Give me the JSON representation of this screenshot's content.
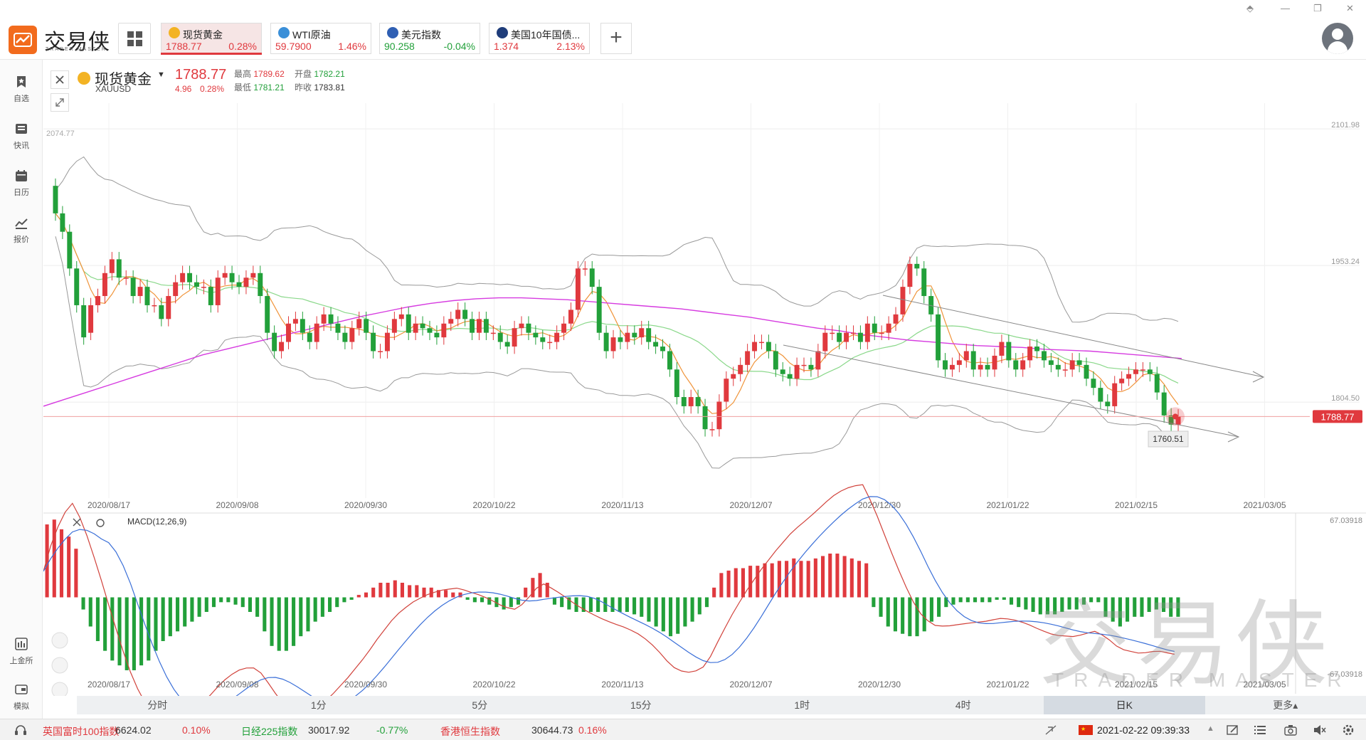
{
  "app": {
    "brand": "交易侠",
    "brand_sub": "TRADER MASTER",
    "window_controls": [
      "⬘",
      "—",
      "❐",
      "✕"
    ]
  },
  "tickers": [
    {
      "name": "现货黄金",
      "price": "1788.77",
      "change": "0.28%",
      "icon_color": "#f3b324",
      "price_color": "#e0393e",
      "active": true
    },
    {
      "name": "WTI原油",
      "price": "59.7900",
      "change": "1.46%",
      "icon_color": "#3a8fd8",
      "price_color": "#e0393e",
      "active": false
    },
    {
      "name": "美元指数",
      "price": "90.258",
      "change": "-0.04%",
      "icon_color": "#2f5fb3",
      "price_color": "#22a03a",
      "active": false
    },
    {
      "name": "美国10年国债...",
      "price": "1.374",
      "change": "2.13%",
      "icon_color": "#1f3d7a",
      "price_color": "#e0393e",
      "active": false
    }
  ],
  "sidebar": {
    "items": [
      {
        "label": "自选",
        "icon": "star-bookmark-icon"
      },
      {
        "label": "快讯",
        "icon": "news-icon"
      },
      {
        "label": "日历",
        "icon": "calendar-icon"
      },
      {
        "label": "报价",
        "icon": "trend-icon"
      }
    ],
    "bottom_items": [
      {
        "label": "上金所",
        "icon": "exchange-icon"
      },
      {
        "label": "模拟",
        "icon": "simulate-icon"
      }
    ]
  },
  "instrument": {
    "name": "现货黄金",
    "code": "XAUUSD",
    "price": "1788.77",
    "change": "4.96",
    "change_pct": "0.28%",
    "stats": {
      "high_label": "最高",
      "high": "1789.62",
      "open_label": "开盘",
      "open": "1782.21",
      "low_label": "最低",
      "low": "1781.21",
      "prev_label": "昨收",
      "prev": "1783.81"
    }
  },
  "chart_data": [
    {
      "type": "candlestick",
      "y_axis_labels": [
        "2101.98",
        "1953.24",
        "1804.50"
      ],
      "top_left_label": "2074.77",
      "last_price_tag": "1788.77",
      "low_tag": "1760.51",
      "x_labels": [
        "2020/08/17",
        "2020/09/08",
        "2020/09/30",
        "2020/10/22",
        "2020/11/13",
        "2020/12/07",
        "2020/12/30",
        "2021/01/22",
        "2021/02/15",
        "2021/03/05"
      ],
      "ylim": [
        1700,
        2130
      ],
      "close": [
        2010,
        1990,
        1950,
        1910,
        1875,
        1910,
        1920,
        1945,
        1960,
        1940,
        1940,
        1920,
        1930,
        1910,
        1910,
        1895,
        1920,
        1935,
        1945,
        1935,
        1930,
        1930,
        1910,
        1940,
        1945,
        1935,
        1930,
        1940,
        1945,
        1920,
        1880,
        1860,
        1870,
        1890,
        1895,
        1880,
        1870,
        1890,
        1900,
        1890,
        1880,
        1870,
        1885,
        1895,
        1880,
        1860,
        1860,
        1880,
        1895,
        1900,
        1880,
        1890,
        1885,
        1880,
        1875,
        1890,
        1895,
        1905,
        1895,
        1880,
        1895,
        1880,
        1880,
        1870,
        1865,
        1885,
        1890,
        1880,
        1875,
        1870,
        1870,
        1880,
        1890,
        1905,
        1950,
        1950,
        1930,
        1880,
        1860,
        1875,
        1870,
        1880,
        1875,
        1885,
        1870,
        1865,
        1860,
        1840,
        1810,
        1800,
        1810,
        1800,
        1775,
        1775,
        1805,
        1830,
        1835,
        1845,
        1860,
        1870,
        1870,
        1860,
        1840,
        1835,
        1830,
        1845,
        1845,
        1840,
        1860,
        1880,
        1880,
        1870,
        1880,
        1880,
        1870,
        1890,
        1880,
        1880,
        1890,
        1900,
        1930,
        1955,
        1950,
        1920,
        1900,
        1850,
        1840,
        1845,
        1850,
        1860,
        1840,
        1845,
        1840,
        1855,
        1870,
        1850,
        1840,
        1850,
        1865,
        1860,
        1850,
        1845,
        1840,
        1840,
        1850,
        1845,
        1830,
        1820,
        1805,
        1800,
        1825,
        1830,
        1835,
        1840,
        1840,
        1835,
        1815,
        1790,
        1780,
        1788.77
      ],
      "open": [
        2040,
        2010,
        1990,
        1950,
        1910,
        1880,
        1910,
        1920,
        1945,
        1960,
        1940,
        1940,
        1920,
        1930,
        1910,
        1910,
        1895,
        1920,
        1935,
        1945,
        1935,
        1930,
        1930,
        1910,
        1940,
        1945,
        1935,
        1930,
        1940,
        1945,
        1920,
        1880,
        1860,
        1870,
        1890,
        1895,
        1880,
        1870,
        1890,
        1900,
        1890,
        1880,
        1870,
        1885,
        1895,
        1880,
        1860,
        1860,
        1880,
        1895,
        1900,
        1880,
        1890,
        1885,
        1880,
        1875,
        1890,
        1895,
        1905,
        1895,
        1880,
        1895,
        1880,
        1880,
        1870,
        1865,
        1885,
        1890,
        1880,
        1875,
        1870,
        1870,
        1880,
        1890,
        1905,
        1950,
        1950,
        1930,
        1880,
        1860,
        1875,
        1870,
        1880,
        1875,
        1885,
        1870,
        1865,
        1860,
        1840,
        1810,
        1800,
        1810,
        1800,
        1775,
        1775,
        1805,
        1830,
        1835,
        1845,
        1860,
        1870,
        1870,
        1860,
        1840,
        1835,
        1830,
        1845,
        1845,
        1840,
        1860,
        1880,
        1880,
        1870,
        1880,
        1880,
        1870,
        1890,
        1880,
        1880,
        1890,
        1900,
        1930,
        1955,
        1950,
        1920,
        1900,
        1850,
        1840,
        1845,
        1850,
        1860,
        1840,
        1845,
        1840,
        1855,
        1870,
        1850,
        1840,
        1850,
        1865,
        1860,
        1850,
        1845,
        1840,
        1840,
        1850,
        1845,
        1830,
        1820,
        1805,
        1800,
        1825,
        1830,
        1835,
        1840,
        1840,
        1835,
        1815,
        1790,
        1780
      ],
      "ma_magenta": [
        1800,
        1808,
        1816,
        1824,
        1832,
        1840,
        1848,
        1856,
        1862,
        1868,
        1874,
        1880,
        1886,
        1892,
        1898,
        1903,
        1908,
        1912,
        1915,
        1917,
        1918,
        1918,
        1917,
        1916,
        1914,
        1912,
        1910,
        1908,
        1906,
        1903,
        1900,
        1897,
        1893,
        1889,
        1885,
        1882,
        1878,
        1875,
        1872,
        1870,
        1868,
        1866,
        1865,
        1864,
        1862,
        1861,
        1860,
        1858,
        1856,
        1854,
        1852
      ]
    },
    {
      "type": "bar",
      "title": "MACD(12,26,9)",
      "y_axis_labels": [
        "67.03918",
        "-67.03918"
      ],
      "x_labels": [
        "2020/08/17",
        "2020/09/08",
        "2020/09/30",
        "2020/10/22",
        "2020/11/13",
        "2020/12/07",
        "2020/12/30",
        "2021/01/22",
        "2021/02/15",
        "2021/03/05"
      ],
      "ylim": [
        -67.03918,
        67.03918
      ],
      "histogram": [
        30,
        32,
        28,
        25,
        20,
        -5,
        -12,
        -18,
        -22,
        -26,
        -28,
        -30,
        -30,
        -28,
        -26,
        -22,
        -18,
        -16,
        -14,
        -12,
        -10,
        -8,
        -6,
        -4,
        -2,
        -2,
        -3,
        -4,
        -6,
        -8,
        -14,
        -20,
        -22,
        -22,
        -20,
        -16,
        -14,
        -10,
        -8,
        -6,
        -4,
        -2,
        -1,
        1,
        2,
        4,
        6,
        6,
        7,
        6,
        5,
        5,
        4,
        4,
        3,
        3,
        2,
        2,
        -1,
        -2,
        -2,
        -3,
        -4,
        -5,
        -4,
        -3,
        4,
        8,
        10,
        6,
        -3,
        -4,
        -5,
        -6,
        -6,
        -6,
        -6,
        -6,
        -6,
        -6,
        -6,
        -7,
        -8,
        -10,
        -12,
        -14,
        -16,
        -15,
        -12,
        -10,
        -7,
        -4,
        4,
        10,
        11,
        12,
        12,
        13,
        13,
        14,
        14,
        15,
        15,
        16,
        15,
        15,
        16,
        17,
        18,
        18,
        17,
        16,
        15,
        14,
        -4,
        -8,
        -12,
        -14,
        -15,
        -16,
        -16,
        -14,
        -10,
        -8,
        -4,
        -3,
        -2,
        -2,
        -2,
        -2,
        -2,
        -1,
        -1,
        -3,
        -4,
        -5,
        -6,
        -7,
        -7,
        -7,
        -6,
        -5,
        -5,
        -3,
        -2,
        -2,
        -8,
        -10,
        -12,
        -10,
        -8,
        -8,
        -6,
        -5,
        -6,
        -8,
        -8
      ]
    }
  ],
  "timeframes": [
    {
      "label": "分时",
      "active": false
    },
    {
      "label": "1分",
      "active": false
    },
    {
      "label": "5分",
      "active": false
    },
    {
      "label": "15分",
      "active": false
    },
    {
      "label": "1时",
      "active": false
    },
    {
      "label": "4时",
      "active": false
    },
    {
      "label": "日K",
      "active": true
    },
    {
      "label": "更多▴",
      "active": false
    }
  ],
  "statusbar": {
    "indices": [
      {
        "name": "英国富时100指数",
        "value": "6624.02",
        "change": "0.10%",
        "dir": "red"
      },
      {
        "name": "日经225指数",
        "value": "30017.92",
        "change": "-0.77%",
        "dir": "green"
      },
      {
        "name": "香港恒生指数",
        "value": "30644.73",
        "change": "0.16%",
        "dir": "red"
      }
    ],
    "datetime": "2021-02-22 09:39:33",
    "flag_color": "#de2910"
  },
  "watermark": {
    "main": "交易侠",
    "sub": "TRADER MASTER"
  }
}
